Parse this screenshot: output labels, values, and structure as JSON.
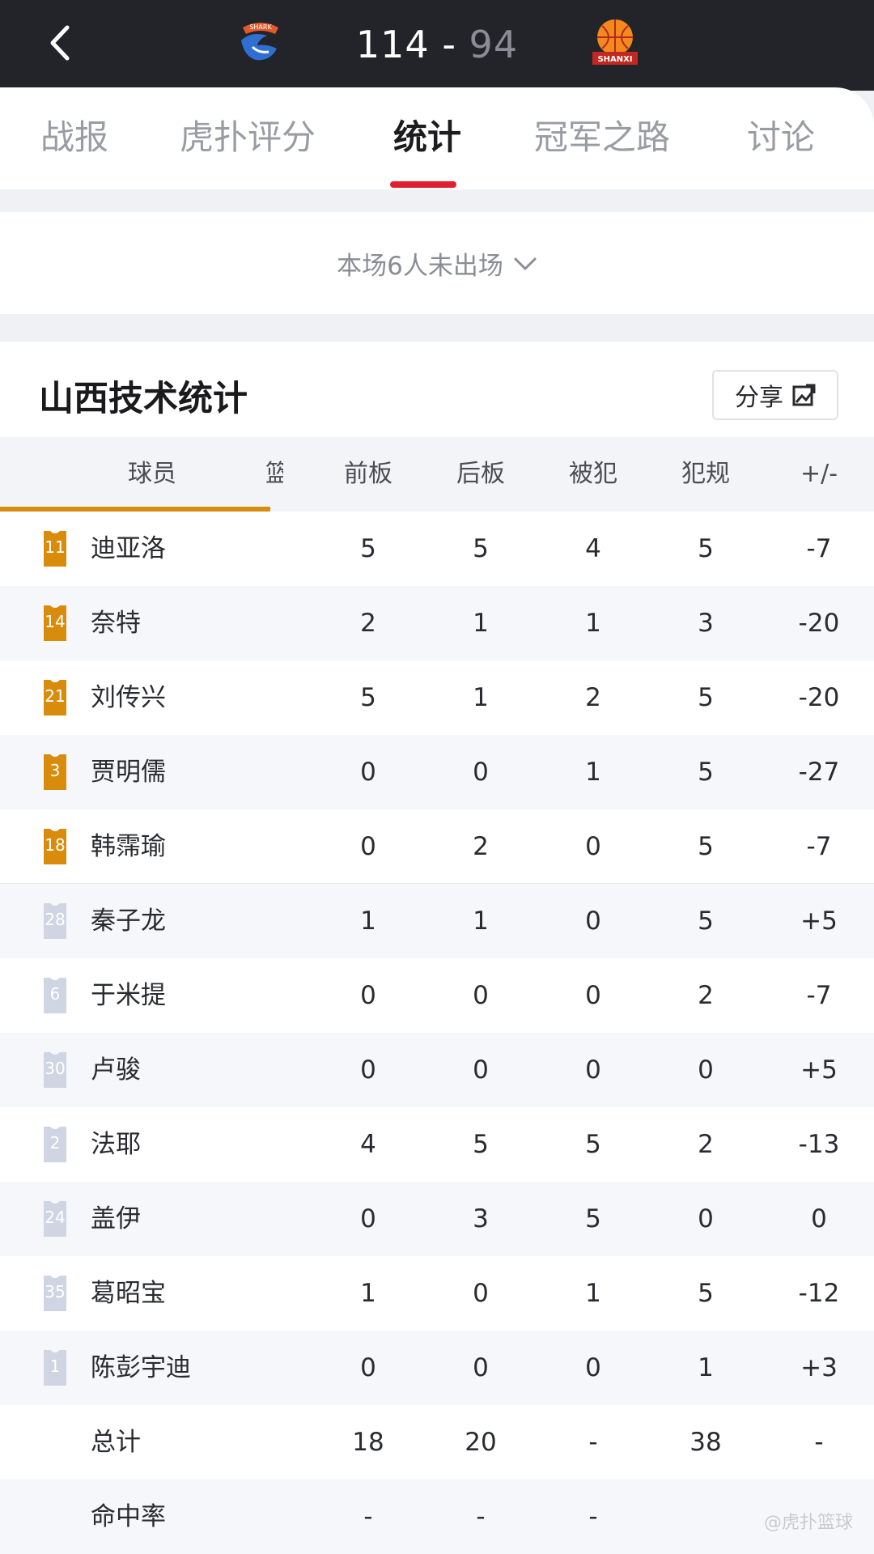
{
  "header": {
    "home_score": "114 - ",
    "away_score": "94",
    "home_logo_text": "SHARK",
    "away_logo_text": "SHANXI"
  },
  "tabs": [
    {
      "label": "战报"
    },
    {
      "label": "虎扑评分"
    },
    {
      "label": "统计"
    },
    {
      "label": "冠军之路"
    },
    {
      "label": "讨论"
    }
  ],
  "notice": "本场6人未出场",
  "section": {
    "title": "山西技术统计",
    "share_label": "分享"
  },
  "table": {
    "headers": {
      "player": "球员",
      "partial": "篮",
      "c1": "前板",
      "c2": "后板",
      "c3": "被犯",
      "c4": "犯规",
      "c5": "+/-"
    },
    "rows": [
      {
        "num": "11",
        "name": "迪亚洛",
        "c1": "5",
        "c2": "5",
        "c3": "4",
        "c4": "5",
        "c5": "-7"
      },
      {
        "num": "14",
        "name": "奈特",
        "c1": "2",
        "c2": "1",
        "c3": "1",
        "c4": "3",
        "c5": "-20"
      },
      {
        "num": "21",
        "name": "刘传兴",
        "c1": "5",
        "c2": "1",
        "c3": "2",
        "c4": "5",
        "c5": "-20"
      },
      {
        "num": "3",
        "name": "贾明儒",
        "c1": "0",
        "c2": "0",
        "c3": "1",
        "c4": "5",
        "c5": "-27"
      },
      {
        "num": "18",
        "name": "韩霈瑜",
        "c1": "0",
        "c2": "2",
        "c3": "0",
        "c4": "5",
        "c5": "-7"
      },
      {
        "num": "28",
        "name": "秦子龙",
        "c1": "1",
        "c2": "1",
        "c3": "0",
        "c4": "5",
        "c5": "+5"
      },
      {
        "num": "6",
        "name": "于米提",
        "c1": "0",
        "c2": "0",
        "c3": "0",
        "c4": "2",
        "c5": "-7"
      },
      {
        "num": "30",
        "name": "卢骏",
        "c1": "0",
        "c2": "0",
        "c3": "0",
        "c4": "0",
        "c5": "+5"
      },
      {
        "num": "2",
        "name": "法耶",
        "c1": "4",
        "c2": "5",
        "c3": "5",
        "c4": "2",
        "c5": "-13"
      },
      {
        "num": "24",
        "name": "盖伊",
        "c1": "0",
        "c2": "3",
        "c3": "5",
        "c4": "0",
        "c5": "0"
      },
      {
        "num": "35",
        "name": "葛昭宝",
        "c1": "1",
        "c2": "0",
        "c3": "1",
        "c4": "5",
        "c5": "-12"
      },
      {
        "num": "1",
        "name": "陈彭宇迪",
        "c1": "0",
        "c2": "0",
        "c3": "0",
        "c4": "1",
        "c5": "+3"
      }
    ],
    "total": {
      "name": "总计",
      "c1": "18",
      "c2": "20",
      "c3": "-",
      "c4": "38",
      "c5": "-"
    },
    "rate": {
      "name": "命中率",
      "c1": "-",
      "c2": "-",
      "c3": "-",
      "c4": "",
      "c5": ""
    }
  },
  "colors": {
    "starter_jersey": "#d98c0c",
    "bench_jersey": "#cfd5e3",
    "active_tab_indicator": "#e0202e",
    "header_bg": "#22242a"
  },
  "watermark": "@虎扑篮球"
}
